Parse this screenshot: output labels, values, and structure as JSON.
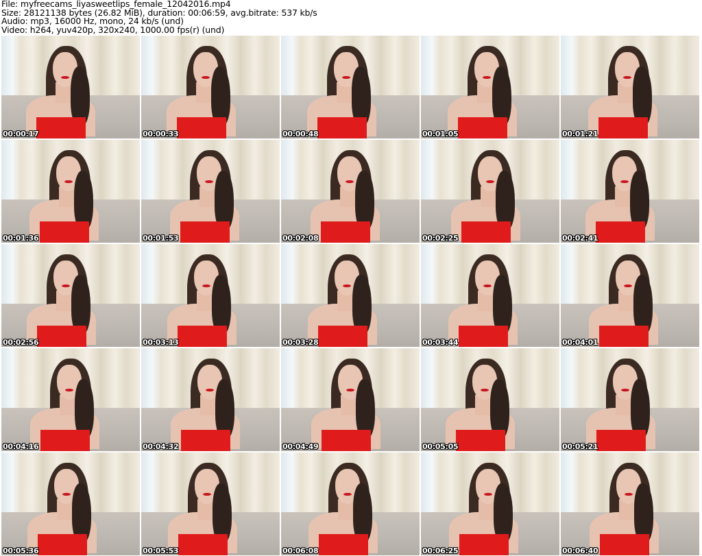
{
  "header": {
    "file": "File: myfreecams_liyasweetlips_female_12042016.mp4",
    "size": "Size: 28121138 bytes (26.82 MiB), duration: 00:06:59, avg.bitrate: 537 kb/s",
    "audio": "Audio: mp3, 16000 Hz, mono, 24 kb/s (und)",
    "video": "Video: h264, yuv420p, 320x240, 1000.00 fps(r) (und)"
  },
  "thumbnails": [
    "00:00:17",
    "00:00:33",
    "00:00:48",
    "00:01:05",
    "00:01:21",
    "00:01:36",
    "00:01:53",
    "00:02:08",
    "00:02:25",
    "00:02:41",
    "00:02:56",
    "00:03:13",
    "00:03:28",
    "00:03:44",
    "00:04:01",
    "00:04:16",
    "00:04:32",
    "00:04:49",
    "00:05:05",
    "00:05:21",
    "00:05:36",
    "00:05:53",
    "00:06:08",
    "00:06:25",
    "00:06:40"
  ]
}
